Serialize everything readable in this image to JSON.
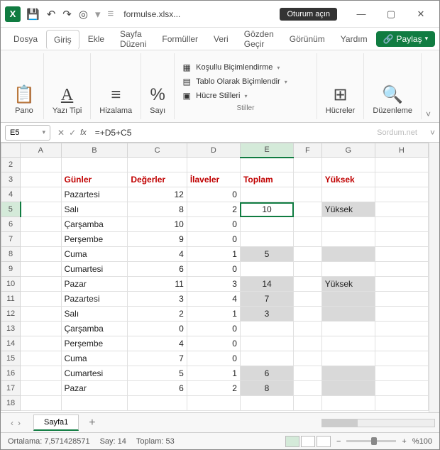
{
  "app": {
    "icon_letter": "X",
    "filename": "formulse.xlsx...",
    "login": "Oturum açın"
  },
  "tabs": {
    "file": "Dosya",
    "home": "Giriş",
    "insert": "Ekle",
    "layout": "Sayfa Düzeni",
    "formulas": "Formüller",
    "data": "Veri",
    "review": "Gözden Geçir",
    "view": "Görünüm",
    "help": "Yardım",
    "share": "Paylaş"
  },
  "ribbon": {
    "pano": "Pano",
    "font": "Yazı Tipi",
    "align": "Hizalama",
    "number": "Sayı",
    "cond": "Koşullu Biçimlendirme",
    "table": "Tablo Olarak Biçimlendir",
    "cellstyle": "Hücre Stilleri",
    "styles": "Stiller",
    "cells": "Hücreler",
    "edit": "Düzenleme"
  },
  "formulabar": {
    "cell_ref": "E5",
    "formula": "=+D5+C5",
    "watermark": "Sordum.net"
  },
  "headers": {
    "B": "Günler",
    "C": "Değerler",
    "D": "İlaveler",
    "E": "Toplam",
    "G": "Yüksek"
  },
  "rows": [
    {
      "n": 2
    },
    {
      "n": 3,
      "header": true
    },
    {
      "n": 4,
      "b": "Pazartesi",
      "c": "12",
      "d": "0"
    },
    {
      "n": 5,
      "b": "Salı",
      "c": "8",
      "d": "2",
      "e": "10",
      "g": "Yüksek",
      "active": true,
      "shadeEG": true
    },
    {
      "n": 6,
      "b": "Çarşamba",
      "c": "10",
      "d": "0"
    },
    {
      "n": 7,
      "b": "Perşembe",
      "c": "9",
      "d": "0"
    },
    {
      "n": 8,
      "b": "Cuma",
      "c": "4",
      "d": "1",
      "e": "5",
      "shadeEG": true
    },
    {
      "n": 9,
      "b": "Cumartesi",
      "c": "6",
      "d": "0"
    },
    {
      "n": 10,
      "b": "Pazar",
      "c": "11",
      "d": "3",
      "e": "14",
      "g": "Yüksek",
      "shadeEG": true
    },
    {
      "n": 11,
      "b": "Pazartesi",
      "c": "3",
      "d": "4",
      "e": "7",
      "shadeEG": true
    },
    {
      "n": 12,
      "b": "Salı",
      "c": "2",
      "d": "1",
      "e": "3",
      "shadeEG": true
    },
    {
      "n": 13,
      "b": "Çarşamba",
      "c": "0",
      "d": "0"
    },
    {
      "n": 14,
      "b": "Perşembe",
      "c": "4",
      "d": "0"
    },
    {
      "n": 15,
      "b": "Cuma",
      "c": "7",
      "d": "0"
    },
    {
      "n": 16,
      "b": "Cumartesi",
      "c": "5",
      "d": "1",
      "e": "6",
      "shadeEG": true
    },
    {
      "n": 17,
      "b": "Pazar",
      "c": "6",
      "d": "2",
      "e": "8",
      "shadeEG": true
    },
    {
      "n": 18
    }
  ],
  "sheet": {
    "name": "Sayfa1"
  },
  "status": {
    "avg_label": "Ortalama:",
    "avg": "7,571428571",
    "count_label": "Say:",
    "count": "14",
    "sum_label": "Toplam:",
    "sum": "53",
    "zoom": "%100"
  }
}
